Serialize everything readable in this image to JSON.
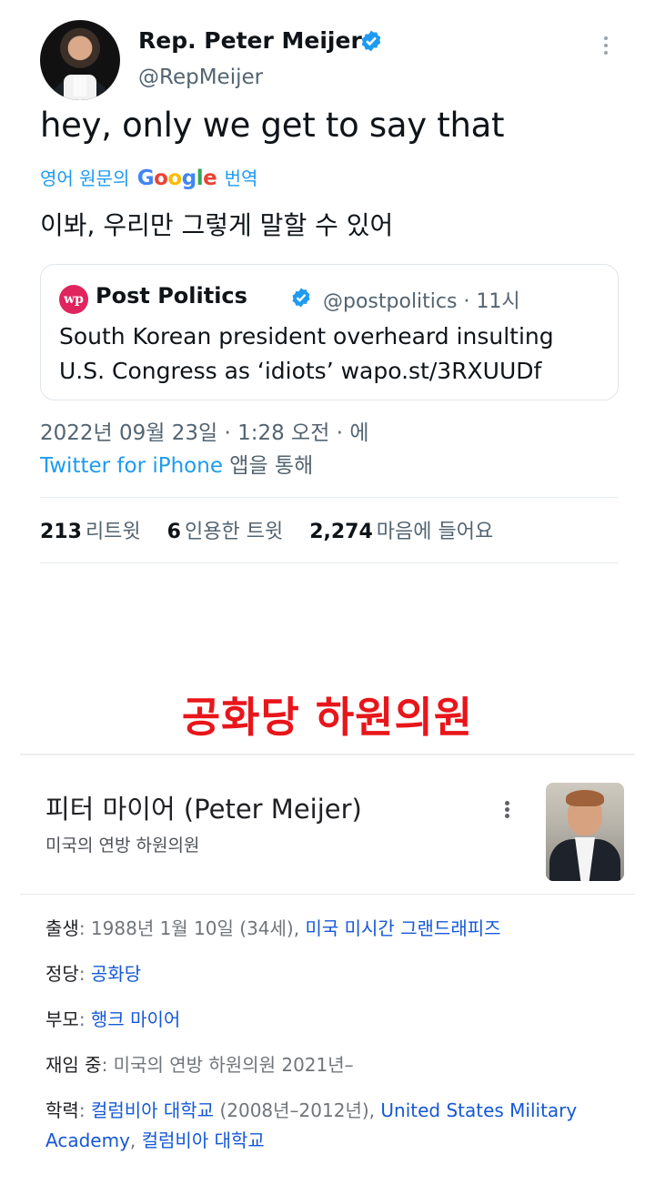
{
  "tweet": {
    "display_name": "Rep. Peter Meijer",
    "handle": "@RepMeijer",
    "text": "hey, only we get to say that",
    "translate_prefix": "영어 원문의",
    "translate_suffix": "번역",
    "translated_text": "이봐, 우리만 그렇게 말할 수 있어",
    "quote": {
      "logo_text": "wp",
      "name": "Post Politics",
      "meta": "@postpolitics · 11시",
      "body": "South Korean president overheard insulting U.S. Congress as ‘idiots’ wapo.st/3RXUUDf"
    },
    "timestamp": "2022년 09월 23일 · 1:28 오전 · 에",
    "source_link": "Twitter for iPhone",
    "source_suffix": "앱을 통해",
    "stats": [
      {
        "count": "213",
        "label": "리트윗"
      },
      {
        "count": "6",
        "label": "인용한 트윗"
      },
      {
        "count": "2,274",
        "label": "마음에 들어요"
      }
    ],
    "verified_color": "#1d9bf0"
  },
  "caption": "공화당 하원의원",
  "knowledge_panel": {
    "title": "피터 마이어 (Peter Meijer)",
    "subtitle": "미국의 연방 하원의원",
    "facts": {
      "birth_key": "출생",
      "birth_value": "1988년 1월 10일 (34세), ",
      "birth_link": "미국 미시간 그랜드래피즈",
      "party_key": "정당",
      "party_link": "공화당",
      "parent_key": "부모",
      "parent_link": "행크 마이어",
      "office_key": "재임 중",
      "office_value": "미국의 연방 하원의원 2021년–",
      "edu_key": "학력",
      "edu_link1": "컬럼비아 대학교",
      "edu_value1": " (2008년–2012년), ",
      "edu_link2": "United States Military Academy",
      "edu_sep": ", ",
      "edu_link3": "컬럼비아 대학교"
    }
  }
}
